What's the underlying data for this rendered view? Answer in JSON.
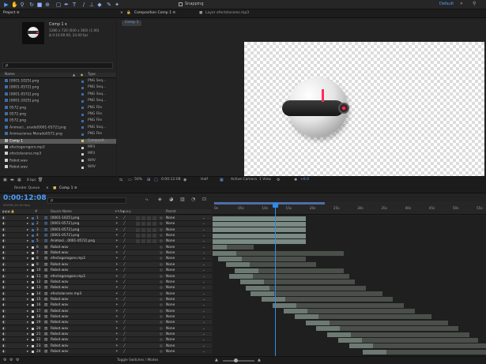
{
  "toolbar": {
    "snapping_label": "Snapping",
    "workspace_label": "Default"
  },
  "project": {
    "tab": "Project ≡",
    "comp_name": "Comp 1 ▾",
    "comp_info_1": "1280 x 720  (640 x 360) (1.00)",
    "comp_info_2": "Δ 0:10:00:00, 24.00 fps",
    "search_placeholder": "ρ",
    "col_name": "Name",
    "col_type": "Type",
    "items": [
      {
        "name": "[0001-1025].png",
        "type": "PNG Seq...",
        "color": "#3d6ea8"
      },
      {
        "name": "[0001-0572].png",
        "type": "PNG Seq...",
        "color": "#3d6ea8"
      },
      {
        "name": "[0001-0572].png",
        "type": "PNG Seq...",
        "color": "#3d6ea8"
      },
      {
        "name": "[0001-1025].png",
        "type": "PNG Seq...",
        "color": "#3d6ea8"
      },
      {
        "name": "0572.png",
        "type": "PNG File",
        "color": "#3d6ea8"
      },
      {
        "name": "0572.png",
        "type": "PNG File",
        "color": "#3d6ea8"
      },
      {
        "name": "0572.png",
        "type": "PNG File",
        "color": "#3d6ea8"
      },
      {
        "name": "Animaci...erado[0001-0572].png",
        "type": "PNG Seq...",
        "color": "#3d6ea8"
      },
      {
        "name": "Animaciones Morado0572.png",
        "type": "PNG File",
        "color": "#3d6ea8"
      },
      {
        "name": "Comp 1",
        "type": "Composit...",
        "color": "#b9b9b9"
      },
      {
        "name": "efectogorogoro.mp3",
        "type": "MP3",
        "color": "#cfcfcf"
      },
      {
        "name": "efectolarares.mp3",
        "type": "MP3",
        "color": "#cfcfcf"
      },
      {
        "name": "Robot.wav",
        "type": "WAV",
        "color": "#cfcfcf"
      },
      {
        "name": "Robot.wav",
        "type": "WAV",
        "color": "#cfcfcf"
      }
    ],
    "bpc": "8 bpc"
  },
  "comp_panel": {
    "tab": "Composition Comp 1 ≡",
    "layer_tab": "Layer efectolarares.mp3",
    "comp_chip": "Comp 1",
    "zoom": "50%",
    "timecode": "0:00:12:08",
    "quality": "Half",
    "camera": "Active Camera",
    "view": "1 View",
    "exposure": "+0.0"
  },
  "timeline": {
    "render_queue_tab": "Render Queue",
    "comp_tab": "Comp 1 ≡",
    "timecode": "0:00:12:08",
    "frame_info": "00296 (24.00 fps)",
    "search_placeholder": "ρ",
    "col_num": "#",
    "col_source": "Source Name",
    "col_parent": "Parent",
    "ruler": [
      "0s",
      "05s",
      "10s",
      "15s",
      "20s",
      "25s",
      "30s",
      "35s",
      "40s",
      "45s",
      "50s",
      "55s"
    ],
    "toggle_label": "Toggle Switches / Modes",
    "layers": [
      {
        "num": "1",
        "name": "[0001-1025].png",
        "parent": "None",
        "start": 0.0,
        "end": 0.34
      },
      {
        "num": "2",
        "name": "[0001-0572].png",
        "parent": "None",
        "start": 0.0,
        "end": 0.34
      },
      {
        "num": "3",
        "name": "[0001-0572].png",
        "parent": "None",
        "start": 0.0,
        "end": 0.34
      },
      {
        "num": "4",
        "name": "[0001-0572].png",
        "parent": "None",
        "start": 0.0,
        "end": 0.34
      },
      {
        "num": "5",
        "name": "Animaci...0001-0572].png",
        "parent": "None",
        "start": 0.0,
        "end": 0.34
      },
      {
        "num": "6",
        "name": "Robot.wav",
        "parent": "None",
        "start": 0.0,
        "end": 0.15
      },
      {
        "num": "7",
        "name": "Robot.wav",
        "parent": "None",
        "start": 0.0,
        "end": 0.48
      },
      {
        "num": "8",
        "name": "efectogorogoro.mp3",
        "parent": "None",
        "start": 0.02,
        "end": 0.34
      },
      {
        "num": "9",
        "name": "Robot.wav",
        "parent": "None",
        "start": 0.05,
        "end": 0.38
      },
      {
        "num": "10",
        "name": "Robot.wav",
        "parent": "None",
        "start": 0.08,
        "end": 0.48
      },
      {
        "num": "11",
        "name": "efectogorogoro.mp3",
        "parent": "None",
        "start": 0.06,
        "end": 0.5
      },
      {
        "num": "12",
        "name": "Robot.wav",
        "parent": "None",
        "start": 0.1,
        "end": 0.52
      },
      {
        "num": "13",
        "name": "Robot.wav",
        "parent": "None",
        "start": 0.12,
        "end": 0.56
      },
      {
        "num": "14",
        "name": "efectolarares.mp3",
        "parent": "None",
        "start": 0.14,
        "end": 0.62
      },
      {
        "num": "15",
        "name": "Robot.wav",
        "parent": "None",
        "start": 0.18,
        "end": 0.66
      },
      {
        "num": "16",
        "name": "Robot.wav",
        "parent": "None",
        "start": 0.22,
        "end": 0.7
      },
      {
        "num": "17",
        "name": "Robot.wav",
        "parent": "None",
        "start": 0.26,
        "end": 0.74
      },
      {
        "num": "18",
        "name": "Robot.wav",
        "parent": "None",
        "start": 0.3,
        "end": 0.8
      },
      {
        "num": "19",
        "name": "Robot.wav",
        "parent": "None",
        "start": 0.34,
        "end": 0.86
      },
      {
        "num": "20",
        "name": "Robot.wav",
        "parent": "None",
        "start": 0.38,
        "end": 0.9
      },
      {
        "num": "21",
        "name": "Robot.wav",
        "parent": "None",
        "start": 0.42,
        "end": 0.94
      },
      {
        "num": "22",
        "name": "Robot.wav",
        "parent": "None",
        "start": 0.46,
        "end": 0.97
      },
      {
        "num": "23",
        "name": "Robot.wav",
        "parent": "None",
        "start": 0.5,
        "end": 1.0
      },
      {
        "num": "24",
        "name": "Robot.wav",
        "parent": "None",
        "start": 0.55,
        "end": 1.0
      }
    ],
    "playhead": 0.227
  },
  "colors": {
    "accent": "#2d8ceb",
    "brand": "#9999ff",
    "playhead": "#2d8ceb"
  }
}
